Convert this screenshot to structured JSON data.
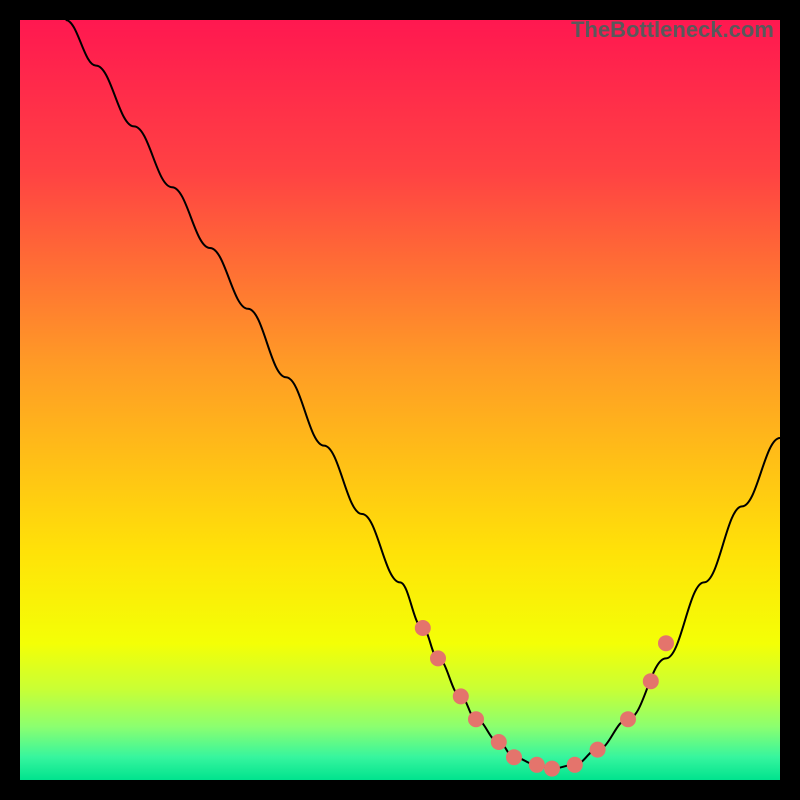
{
  "watermark": "TheBottleneck.com",
  "chart_data": {
    "type": "line",
    "title": "",
    "xlabel": "",
    "ylabel": "",
    "xlim": [
      0,
      100
    ],
    "ylim": [
      0,
      100
    ],
    "grid": false,
    "legend": false,
    "curve_description": "V-shaped bottleneck curve: starts top-left, descends through midsection to a broad flat minimum around x≈60–70 near the bottom, then rises toward the right edge ending around y≈45.",
    "series": [
      {
        "name": "bottleneck-curve",
        "color": "#000000",
        "x": [
          6,
          10,
          15,
          20,
          25,
          30,
          35,
          40,
          45,
          50,
          53,
          55,
          58,
          60,
          63,
          65,
          68,
          70,
          73,
          76,
          80,
          85,
          90,
          95,
          100
        ],
        "y": [
          100,
          94,
          86,
          78,
          70,
          62,
          53,
          44,
          35,
          26,
          20,
          16,
          11,
          8,
          5,
          3,
          2,
          1.5,
          2,
          4,
          8,
          16,
          26,
          36,
          45
        ]
      }
    ],
    "markers": {
      "name": "highlight-dots",
      "color": "#e4746c",
      "radius_px": 8,
      "points_xy": [
        [
          53,
          20
        ],
        [
          55,
          16
        ],
        [
          58,
          11
        ],
        [
          60,
          8
        ],
        [
          63,
          5
        ],
        [
          65,
          3
        ],
        [
          68,
          2
        ],
        [
          70,
          1.5
        ],
        [
          73,
          2
        ],
        [
          76,
          4
        ],
        [
          80,
          8
        ],
        [
          83,
          13
        ],
        [
          85,
          18
        ]
      ]
    },
    "background_gradient": {
      "direction": "top-to-bottom",
      "stops": [
        {
          "offset": 0.0,
          "color": "#ff1850"
        },
        {
          "offset": 0.2,
          "color": "#ff4243"
        },
        {
          "offset": 0.45,
          "color": "#ff9a26"
        },
        {
          "offset": 0.7,
          "color": "#ffe208"
        },
        {
          "offset": 0.82,
          "color": "#f4ff06"
        },
        {
          "offset": 0.88,
          "color": "#c9ff34"
        },
        {
          "offset": 0.93,
          "color": "#8bff70"
        },
        {
          "offset": 0.97,
          "color": "#36f59e"
        },
        {
          "offset": 1.0,
          "color": "#00e38e"
        }
      ]
    }
  }
}
